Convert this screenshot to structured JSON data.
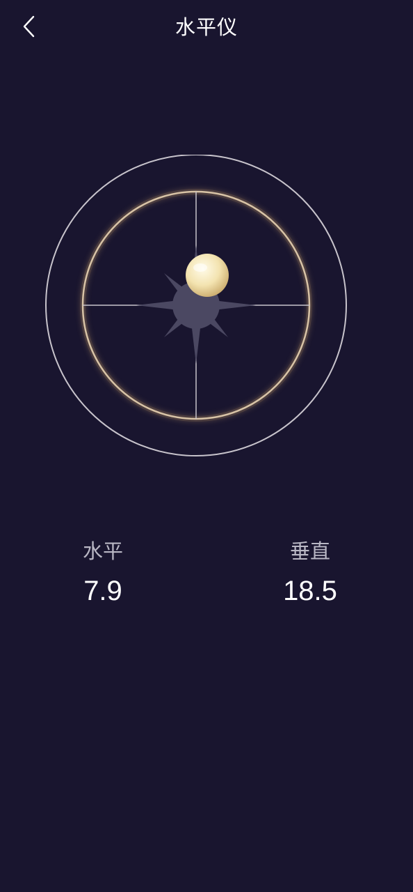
{
  "header": {
    "title": "水平仪",
    "back_icon": "chevron-left-icon"
  },
  "gauge": {
    "horizontal_tilt": 7.9,
    "vertical_tilt": 18.5,
    "bubble_color": "#f3e3b0",
    "ring_color": "#c8c4cc",
    "inner_ring_glow": "#caa77a",
    "center_star_color": "#4b4862"
  },
  "readings": {
    "horizontal": {
      "label": "水平",
      "value": "7.9"
    },
    "vertical": {
      "label": "垂直",
      "value": "18.5"
    }
  },
  "colors": {
    "background": "#19152f",
    "text_primary": "#ffffff",
    "text_secondary": "#b9b7c4"
  }
}
